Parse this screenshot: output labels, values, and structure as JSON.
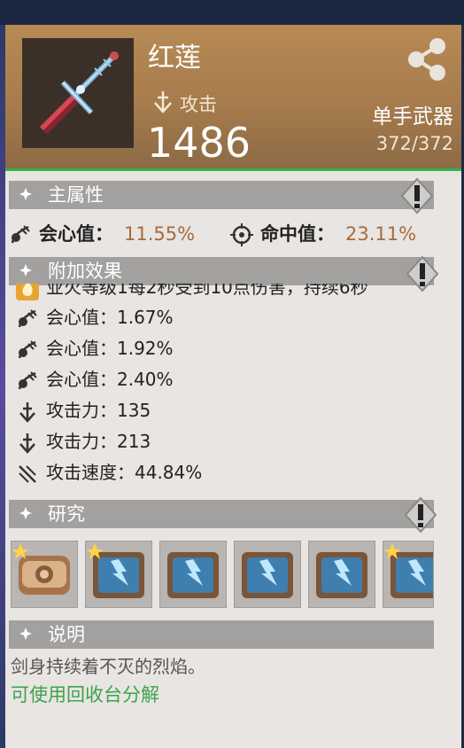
{
  "item": {
    "name": "红莲",
    "attack_label": "攻击",
    "attack_value": "1486",
    "type": "单手武器",
    "durability": "372/372"
  },
  "sections": {
    "main_attr_title": "主属性",
    "extra_title": "附加效果",
    "research_title": "研究",
    "desc_title": "说明"
  },
  "main_attributes": [
    {
      "label": "会心值：",
      "value": "11.55%",
      "icon": "crit-icon"
    },
    {
      "label": "命中值：",
      "value": "23.11%",
      "icon": "target-icon"
    }
  ],
  "extra_effects": [
    {
      "text": "业火等级1每2秒受到10点伤害，持续6秒",
      "icon": "fire-effect-icon"
    },
    {
      "text": "会心值：1.67%",
      "icon": "crit-icon"
    },
    {
      "text": "会心值：1.92%",
      "icon": "crit-icon"
    },
    {
      "text": "会心值：2.40%",
      "icon": "crit-icon"
    },
    {
      "text": "攻击力：135",
      "icon": "attack-icon"
    },
    {
      "text": "攻击力：213",
      "icon": "attack-icon"
    },
    {
      "text": "攻击速度：44.84%",
      "icon": "attack-speed-icon"
    }
  ],
  "research_slots": [
    {
      "icon": "leather-pouch-icon",
      "starred": true
    },
    {
      "icon": "ice-research-book-icon",
      "starred": true
    },
    {
      "icon": "ice-research-book-icon",
      "starred": false
    },
    {
      "icon": "ice-research-book-icon",
      "starred": false
    },
    {
      "icon": "ice-research-book-icon",
      "starred": false
    },
    {
      "icon": "ice-research-book-icon",
      "starred": true
    }
  ],
  "description": "剑身持续着不灭的烈焰。",
  "recycle_hint": "可使用回收台分解",
  "colors": {
    "header": "#b08352",
    "highlight_value": "#a86a3a",
    "recycle_text": "#3ea34a",
    "header_divider": "#33b24a"
  }
}
